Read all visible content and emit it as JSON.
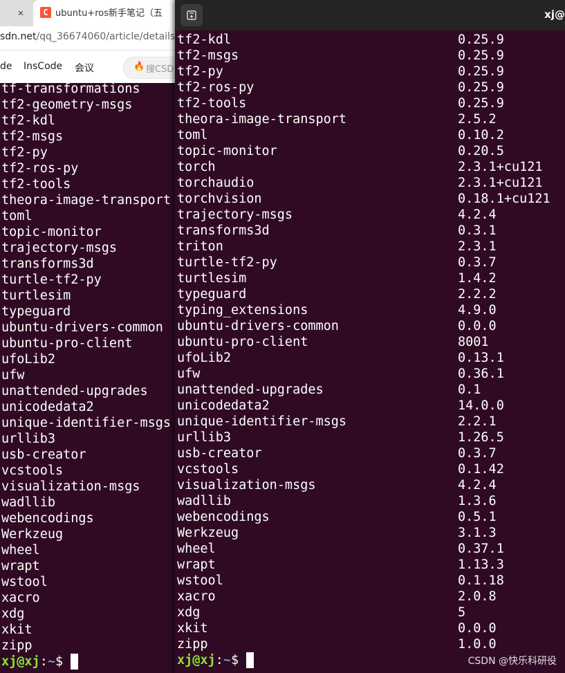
{
  "browser": {
    "tab_close_icon": "close-icon",
    "tab_title": "ubuntu+ros新手笔记（五",
    "favicon_letter": "C",
    "url_host": "sdn.net",
    "url_path": "/qq_36674060/article/details",
    "nav": [
      "de",
      "InsCode",
      "会议"
    ],
    "search_placeholder": "搜CSD",
    "search_icon": "flame-icon"
  },
  "background_terminal": {
    "lines": [
      "tf-transformations",
      "tf2-geometry-msgs",
      "tf2-kdl",
      "tf2-msgs",
      "tf2-py",
      "tf2-ros-py",
      "tf2-tools",
      "theora-image-transport",
      "toml",
      "topic-monitor",
      "trajectory-msgs",
      "transforms3d",
      "turtle-tf2-py",
      "turtlesim",
      "typeguard",
      "ubuntu-drivers-common",
      "ubuntu-pro-client",
      "ufoLib2",
      "ufw",
      "unattended-upgrades",
      "unicodedata2",
      "unique-identifier-msgs",
      "urllib3",
      "usb-creator",
      "vcstools",
      "visualization-msgs",
      "wadllib",
      "webencodings",
      "Werkzeug",
      "wheel",
      "wrapt",
      "wstool",
      "xacro",
      "xdg",
      "xkit",
      "zipp"
    ],
    "prompt_user": "xj@xj",
    "prompt_sep": ":",
    "prompt_path": "~",
    "prompt_symbol": "$ "
  },
  "terminal": {
    "title": "xj@",
    "new_tab_icon": "new-tab-icon",
    "rows": [
      {
        "name": "tf2-kdl",
        "version": "0.25.9"
      },
      {
        "name": "tf2-msgs",
        "version": "0.25.9"
      },
      {
        "name": "tf2-py",
        "version": "0.25.9"
      },
      {
        "name": "tf2-ros-py",
        "version": "0.25.9"
      },
      {
        "name": "tf2-tools",
        "version": "0.25.9"
      },
      {
        "name": "theora-image-transport",
        "version": "2.5.2"
      },
      {
        "name": "toml",
        "version": "0.10.2"
      },
      {
        "name": "topic-monitor",
        "version": "0.20.5"
      },
      {
        "name": "torch",
        "version": "2.3.1+cu121"
      },
      {
        "name": "torchaudio",
        "version": "2.3.1+cu121"
      },
      {
        "name": "torchvision",
        "version": "0.18.1+cu121"
      },
      {
        "name": "trajectory-msgs",
        "version": "4.2.4"
      },
      {
        "name": "transforms3d",
        "version": "0.3.1"
      },
      {
        "name": "triton",
        "version": "2.3.1"
      },
      {
        "name": "turtle-tf2-py",
        "version": "0.3.7"
      },
      {
        "name": "turtlesim",
        "version": "1.4.2"
      },
      {
        "name": "typeguard",
        "version": "2.2.2"
      },
      {
        "name": "typing_extensions",
        "version": "4.9.0"
      },
      {
        "name": "ubuntu-drivers-common",
        "version": "0.0.0"
      },
      {
        "name": "ubuntu-pro-client",
        "version": "8001"
      },
      {
        "name": "ufoLib2",
        "version": "0.13.1"
      },
      {
        "name": "ufw",
        "version": "0.36.1"
      },
      {
        "name": "unattended-upgrades",
        "version": "0.1"
      },
      {
        "name": "unicodedata2",
        "version": "14.0.0"
      },
      {
        "name": "unique-identifier-msgs",
        "version": "2.2.1"
      },
      {
        "name": "urllib3",
        "version": "1.26.5"
      },
      {
        "name": "usb-creator",
        "version": "0.3.7"
      },
      {
        "name": "vcstools",
        "version": "0.1.42"
      },
      {
        "name": "visualization-msgs",
        "version": "4.2.4"
      },
      {
        "name": "wadllib",
        "version": "1.3.6"
      },
      {
        "name": "webencodings",
        "version": "0.5.1"
      },
      {
        "name": "Werkzeug",
        "version": "3.1.3"
      },
      {
        "name": "wheel",
        "version": "0.37.1"
      },
      {
        "name": "wrapt",
        "version": "1.13.3"
      },
      {
        "name": "wstool",
        "version": "0.1.18"
      },
      {
        "name": "xacro",
        "version": "2.0.8"
      },
      {
        "name": "xdg",
        "version": "5"
      },
      {
        "name": "xkit",
        "version": "0.0.0"
      },
      {
        "name": "zipp",
        "version": "1.0.0"
      }
    ],
    "prompt_user": "xj@xj",
    "prompt_sep": ":",
    "prompt_path": "~",
    "prompt_symbol": "$ "
  },
  "watermark": "CSDN @快乐科研役",
  "colors": {
    "terminal_bg": "#300a24",
    "prompt_user": "#8ae234",
    "prompt_path": "#729fcf",
    "text": "#ffffff"
  }
}
